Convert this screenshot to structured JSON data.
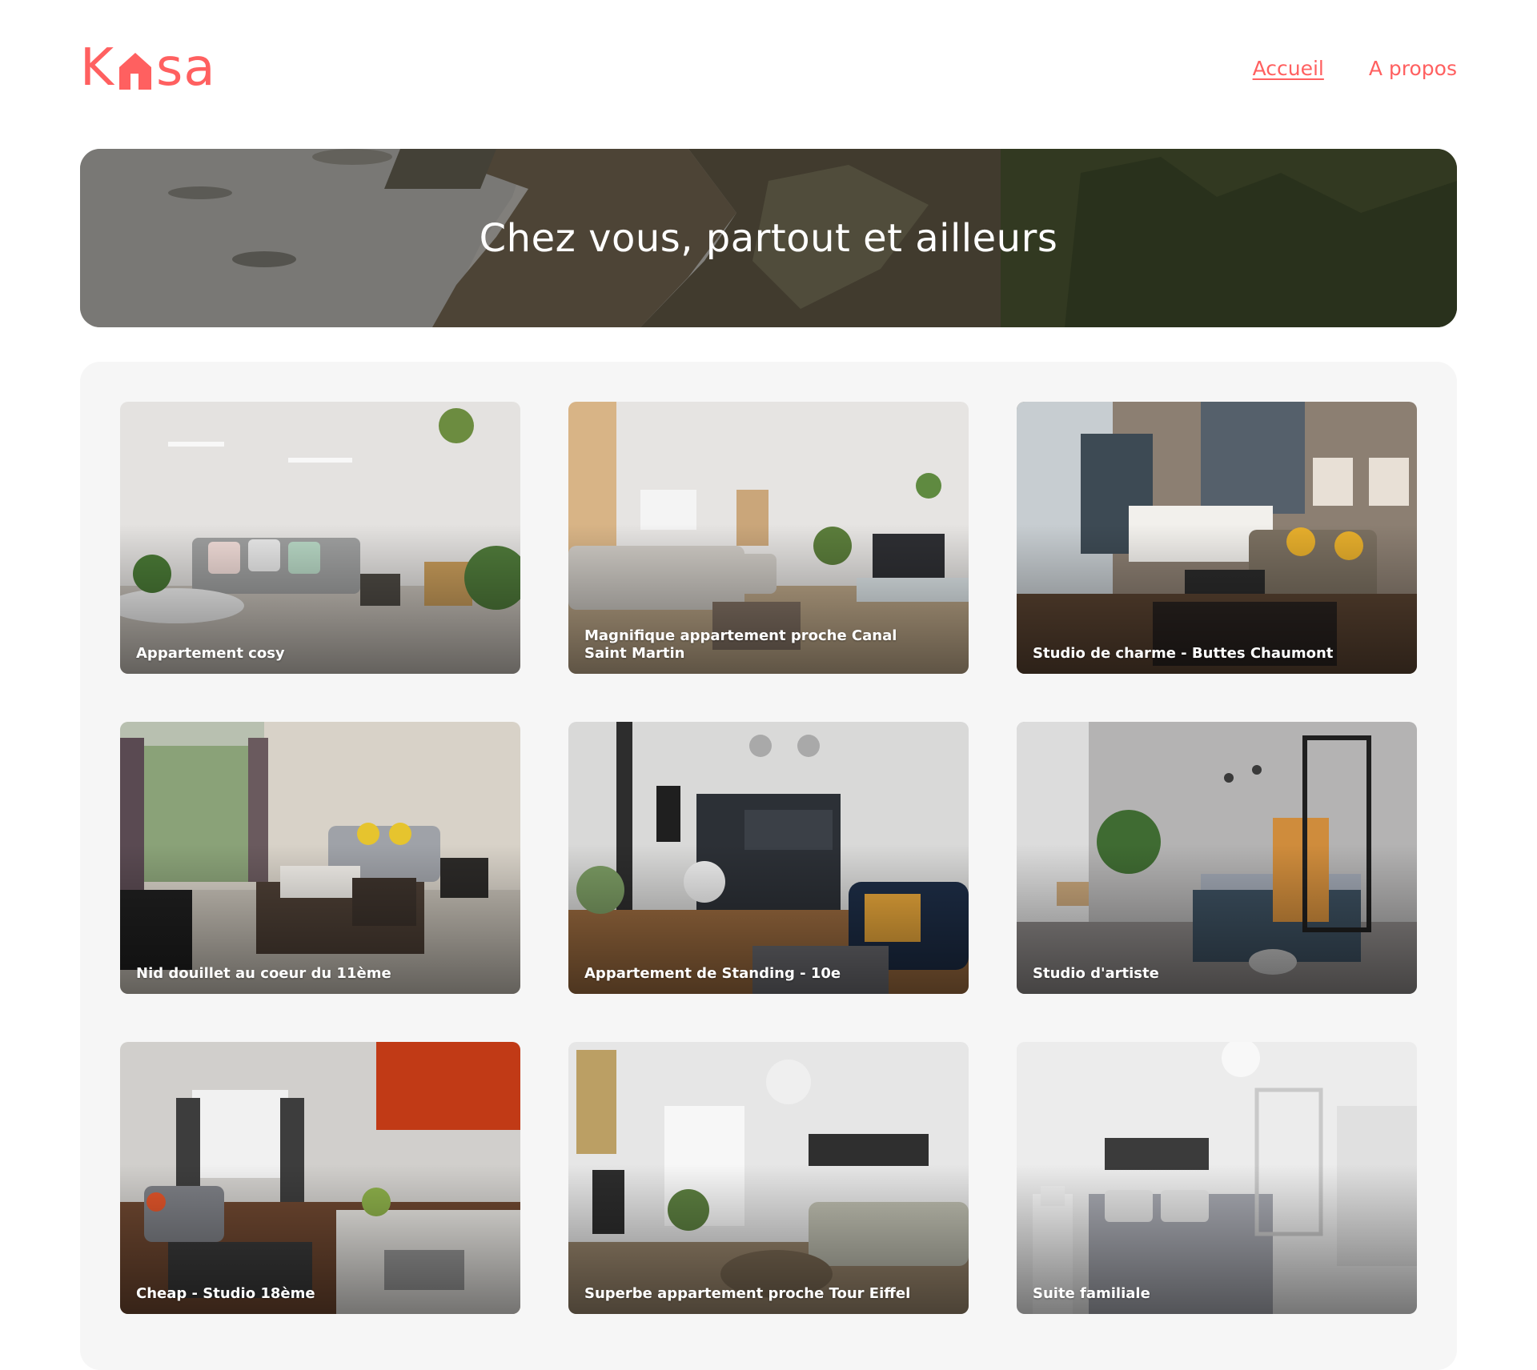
{
  "brand": {
    "logo_letters_left": "K",
    "logo_letters_right": "sa",
    "color": "#ff6060"
  },
  "nav": {
    "items": [
      {
        "label": "Accueil",
        "active": true
      },
      {
        "label": "A propos",
        "active": false
      }
    ]
  },
  "hero": {
    "title": "Chez vous, partout et ailleurs"
  },
  "listings": [
    {
      "title": "Appartement cosy",
      "theme": "light"
    },
    {
      "title": "Magnifique appartement proche Canal Saint Martin",
      "theme": "light"
    },
    {
      "title": "Studio de charme - Buttes Chaumont",
      "theme": "warm"
    },
    {
      "title": "Nid douillet au coeur du 11ème",
      "theme": "warm"
    },
    {
      "title": "Appartement de Standing - 10e",
      "theme": "dark-blue"
    },
    {
      "title": "Studio d'artiste",
      "theme": "grey"
    },
    {
      "title": "Cheap - Studio 18ème",
      "theme": "kitchen"
    },
    {
      "title": "Superbe appartement proche Tour Eiffel",
      "theme": "light"
    },
    {
      "title": "Suite familiale",
      "theme": "white"
    }
  ]
}
